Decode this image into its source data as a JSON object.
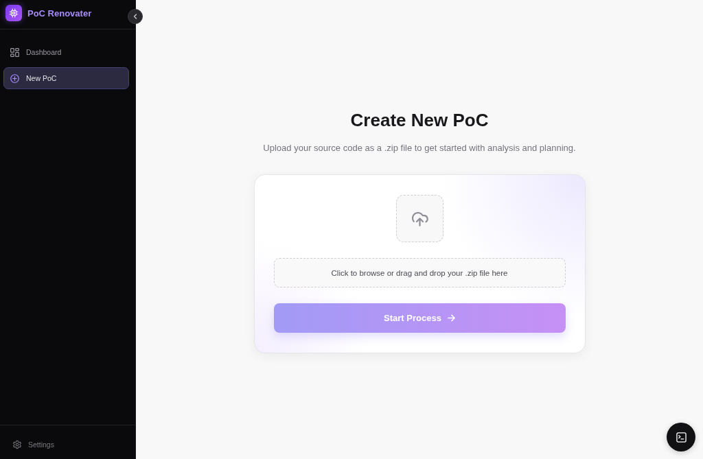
{
  "sidebar": {
    "brand": "PoC Renovater",
    "nav": [
      {
        "label": "Dashboard",
        "selected": false
      },
      {
        "label": "New PoC",
        "selected": true
      }
    ],
    "footer": {
      "label": "Settings"
    }
  },
  "main": {
    "title": "Create New PoC",
    "subtitle": "Upload your source code as a .zip file to get started with analysis and planning.",
    "upload_card": {
      "dropzone": {
        "label": "Click to browse or drag and drop your .zip file here"
      },
      "submit_button": {
        "label": "Start Process"
      }
    }
  }
}
